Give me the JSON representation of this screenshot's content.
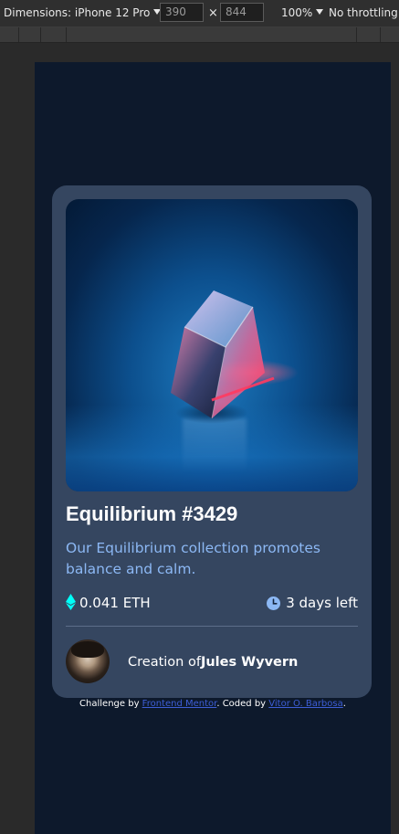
{
  "devtools": {
    "dimensions_label": "Dimensions: iPhone 12 Pro",
    "width_value": "390",
    "times": "×",
    "height_value": "844",
    "zoom": "100%",
    "throttling": "No throttling"
  },
  "card": {
    "title": "Equilibrium #3429",
    "description": "Our Equilibrium collection promotes balance and calm.",
    "price": "0.041 ETH",
    "time_left": "3 days left",
    "creator_prefix": "Creation of",
    "creator_name": "Jules Wyvern"
  },
  "footer": {
    "prefix": "Challenge by ",
    "link1": "Frontend Mentor",
    "middle": ". Coded by ",
    "link2": "Vitor O. Barbosa",
    "suffix": "."
  },
  "colors": {
    "page_bg": "#0d192c",
    "card_bg": "#354660",
    "accent_cyan": "#00fff8",
    "soft_blue": "#8cb8f4",
    "link_blue": "#3d5ed6"
  },
  "icons": [
    "ethereum-icon",
    "clock-icon"
  ]
}
